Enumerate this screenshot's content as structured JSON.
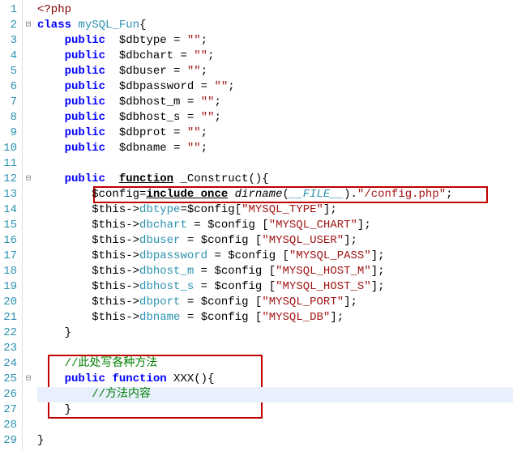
{
  "lines": [
    {
      "n": 1,
      "fold": "",
      "segs": [
        [
          "php",
          "<?php"
        ]
      ]
    },
    {
      "n": 2,
      "fold": "⊟",
      "segs": [
        [
          "kw",
          "class"
        ],
        [
          "op",
          " "
        ],
        [
          "cls",
          "mySQL_Fun"
        ],
        [
          "op",
          "{"
        ]
      ]
    },
    {
      "n": 3,
      "fold": "",
      "segs": [
        [
          "op",
          "    "
        ],
        [
          "kw",
          "public"
        ],
        [
          "op",
          "  "
        ],
        [
          "var",
          "$dbtype"
        ],
        [
          "op",
          " = "
        ],
        [
          "str",
          "\"\""
        ],
        [
          "op",
          ";"
        ]
      ]
    },
    {
      "n": 4,
      "fold": "",
      "segs": [
        [
          "op",
          "    "
        ],
        [
          "kw",
          "public"
        ],
        [
          "op",
          "  "
        ],
        [
          "var",
          "$dbchart"
        ],
        [
          "op",
          " = "
        ],
        [
          "str",
          "\"\""
        ],
        [
          "op",
          ";"
        ]
      ]
    },
    {
      "n": 5,
      "fold": "",
      "segs": [
        [
          "op",
          "    "
        ],
        [
          "kw",
          "public"
        ],
        [
          "op",
          "  "
        ],
        [
          "var",
          "$dbuser"
        ],
        [
          "op",
          " = "
        ],
        [
          "str",
          "\"\""
        ],
        [
          "op",
          ";"
        ]
      ]
    },
    {
      "n": 6,
      "fold": "",
      "segs": [
        [
          "op",
          "    "
        ],
        [
          "kw",
          "public"
        ],
        [
          "op",
          "  "
        ],
        [
          "var",
          "$dbpassword"
        ],
        [
          "op",
          " = "
        ],
        [
          "str",
          "\"\""
        ],
        [
          "op",
          ";"
        ]
      ]
    },
    {
      "n": 7,
      "fold": "",
      "segs": [
        [
          "op",
          "    "
        ],
        [
          "kw",
          "public"
        ],
        [
          "op",
          "  "
        ],
        [
          "var",
          "$dbhost_m"
        ],
        [
          "op",
          " = "
        ],
        [
          "str",
          "\"\""
        ],
        [
          "op",
          ";"
        ]
      ]
    },
    {
      "n": 8,
      "fold": "",
      "segs": [
        [
          "op",
          "    "
        ],
        [
          "kw",
          "public"
        ],
        [
          "op",
          "  "
        ],
        [
          "var",
          "$dbhost_s"
        ],
        [
          "op",
          " = "
        ],
        [
          "str",
          "\"\""
        ],
        [
          "op",
          ";"
        ]
      ]
    },
    {
      "n": 9,
      "fold": "",
      "segs": [
        [
          "op",
          "    "
        ],
        [
          "kw",
          "public"
        ],
        [
          "op",
          "  "
        ],
        [
          "var",
          "$dbprot"
        ],
        [
          "op",
          " = "
        ],
        [
          "str",
          "\"\""
        ],
        [
          "op",
          ";"
        ]
      ]
    },
    {
      "n": 10,
      "fold": "",
      "segs": [
        [
          "op",
          "    "
        ],
        [
          "kw",
          "public"
        ],
        [
          "op",
          "  "
        ],
        [
          "var",
          "$dbname"
        ],
        [
          "op",
          " = "
        ],
        [
          "str",
          "\"\""
        ],
        [
          "op",
          ";"
        ]
      ]
    },
    {
      "n": 11,
      "fold": "",
      "segs": []
    },
    {
      "n": 12,
      "fold": "⊟",
      "segs": [
        [
          "op",
          "    "
        ],
        [
          "kw",
          "public"
        ],
        [
          "op",
          "  "
        ],
        [
          "fn",
          "function"
        ],
        [
          "op",
          " _Construct(){"
        ]
      ]
    },
    {
      "n": 13,
      "fold": "",
      "segs": [
        [
          "op",
          "        "
        ],
        [
          "var",
          "$config"
        ],
        [
          "op",
          "="
        ],
        [
          "fn",
          "include_once"
        ],
        [
          "op",
          " "
        ],
        [
          "fn2",
          "dirname"
        ],
        [
          "op",
          "("
        ],
        [
          "const",
          "__FILE__"
        ],
        [
          "op",
          ")."
        ],
        [
          "str",
          "\"/config.php\""
        ],
        [
          "op",
          ";"
        ]
      ]
    },
    {
      "n": 14,
      "fold": "",
      "segs": [
        [
          "op",
          "        "
        ],
        [
          "var",
          "$this"
        ],
        [
          "op",
          "->"
        ],
        [
          "prop",
          "dbtype"
        ],
        [
          "op",
          "="
        ],
        [
          "var",
          "$config"
        ],
        [
          "op",
          "["
        ],
        [
          "str",
          "\"MYSQL_TYPE\""
        ],
        [
          "op",
          "];"
        ]
      ]
    },
    {
      "n": 15,
      "fold": "",
      "segs": [
        [
          "op",
          "        "
        ],
        [
          "var",
          "$this"
        ],
        [
          "op",
          "->"
        ],
        [
          "prop",
          "dbchart"
        ],
        [
          "op",
          " = "
        ],
        [
          "var",
          "$config"
        ],
        [
          "op",
          " ["
        ],
        [
          "str",
          "\"MYSQL_CHART\""
        ],
        [
          "op",
          "];"
        ]
      ]
    },
    {
      "n": 16,
      "fold": "",
      "segs": [
        [
          "op",
          "        "
        ],
        [
          "var",
          "$this"
        ],
        [
          "op",
          "->"
        ],
        [
          "prop",
          "dbuser"
        ],
        [
          "op",
          " = "
        ],
        [
          "var",
          "$config"
        ],
        [
          "op",
          " ["
        ],
        [
          "str",
          "\"MYSQL_USER\""
        ],
        [
          "op",
          "];"
        ]
      ]
    },
    {
      "n": 17,
      "fold": "",
      "segs": [
        [
          "op",
          "        "
        ],
        [
          "var",
          "$this"
        ],
        [
          "op",
          "->"
        ],
        [
          "prop",
          "dbpassword"
        ],
        [
          "op",
          " = "
        ],
        [
          "var",
          "$config"
        ],
        [
          "op",
          " ["
        ],
        [
          "str",
          "\"MYSQL_PASS\""
        ],
        [
          "op",
          "];"
        ]
      ]
    },
    {
      "n": 18,
      "fold": "",
      "segs": [
        [
          "op",
          "        "
        ],
        [
          "var",
          "$this"
        ],
        [
          "op",
          "->"
        ],
        [
          "prop",
          "dbhost_m"
        ],
        [
          "op",
          " = "
        ],
        [
          "var",
          "$config"
        ],
        [
          "op",
          " ["
        ],
        [
          "str",
          "\"MYSQL_HOST_M\""
        ],
        [
          "op",
          "];"
        ]
      ]
    },
    {
      "n": 19,
      "fold": "",
      "segs": [
        [
          "op",
          "        "
        ],
        [
          "var",
          "$this"
        ],
        [
          "op",
          "->"
        ],
        [
          "prop",
          "dbhost_s"
        ],
        [
          "op",
          " = "
        ],
        [
          "var",
          "$config"
        ],
        [
          "op",
          " ["
        ],
        [
          "str",
          "\"MYSQL_HOST_S\""
        ],
        [
          "op",
          "];"
        ]
      ]
    },
    {
      "n": 20,
      "fold": "",
      "segs": [
        [
          "op",
          "        "
        ],
        [
          "var",
          "$this"
        ],
        [
          "op",
          "->"
        ],
        [
          "prop",
          "dbport"
        ],
        [
          "op",
          " = "
        ],
        [
          "var",
          "$config"
        ],
        [
          "op",
          " ["
        ],
        [
          "str",
          "\"MYSQL_PORT\""
        ],
        [
          "op",
          "];"
        ]
      ]
    },
    {
      "n": 21,
      "fold": "",
      "segs": [
        [
          "op",
          "        "
        ],
        [
          "var",
          "$this"
        ],
        [
          "op",
          "->"
        ],
        [
          "prop",
          "dbname"
        ],
        [
          "op",
          " = "
        ],
        [
          "var",
          "$config"
        ],
        [
          "op",
          " ["
        ],
        [
          "str",
          "\"MYSQL_DB\""
        ],
        [
          "op",
          "];"
        ]
      ]
    },
    {
      "n": 22,
      "fold": "",
      "segs": [
        [
          "op",
          "    }"
        ]
      ]
    },
    {
      "n": 23,
      "fold": "",
      "segs": []
    },
    {
      "n": 24,
      "fold": "",
      "segs": [
        [
          "op",
          "    "
        ],
        [
          "cmt",
          "//此处写各种方法"
        ]
      ]
    },
    {
      "n": 25,
      "fold": "⊟",
      "segs": [
        [
          "op",
          "    "
        ],
        [
          "kw",
          "public"
        ],
        [
          "op",
          " "
        ],
        [
          "kw",
          "function"
        ],
        [
          "op",
          " XXX(){"
        ]
      ]
    },
    {
      "n": 26,
      "fold": "",
      "hl": true,
      "segs": [
        [
          "op",
          "        "
        ],
        [
          "cmt",
          "//方法内容"
        ]
      ]
    },
    {
      "n": 27,
      "fold": "",
      "segs": [
        [
          "op",
          "    }"
        ]
      ]
    },
    {
      "n": 28,
      "fold": "",
      "segs": []
    },
    {
      "n": 29,
      "fold": "",
      "segs": [
        [
          "op",
          "}"
        ]
      ]
    }
  ]
}
